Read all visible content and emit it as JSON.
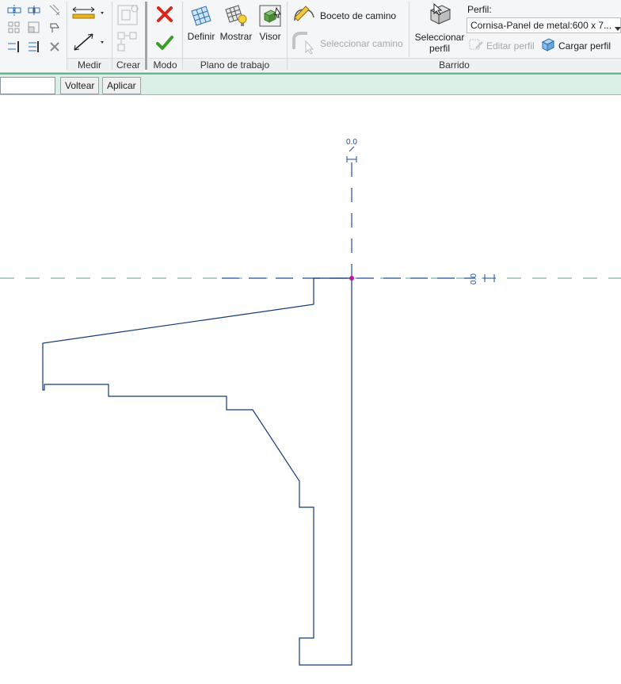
{
  "ribbon": {
    "panels": {
      "medir": "Medir",
      "crear": "Crear",
      "modo": "Modo",
      "plano": "Plano de trabajo",
      "barrido": "Barrido"
    },
    "buttons": {
      "definir": "Definir",
      "mostrar": "Mostrar",
      "visor": "Visor",
      "boceto_camino": "Boceto de camino",
      "seleccionar_camino": "Seleccionar camino",
      "seleccionar_perfil_1": "Seleccionar",
      "seleccionar_perfil_2": "perfil",
      "editar_perfil": "Editar perfil",
      "cargar_perfil": "Cargar perfil"
    },
    "profile": {
      "label": "Perfil:",
      "value": "Cornisa-Panel de metal:600 x 7..."
    }
  },
  "options_bar": {
    "input_value": "",
    "voltear": "Voltear",
    "aplicar": "Aplicar"
  },
  "canvas": {
    "ref_label_top": "0.0",
    "ref_label_right": "0.0"
  },
  "colors": {
    "accent_green": "#5fb88f",
    "sketch_blue": "#123a78",
    "origin_magenta": "#c0188c",
    "cancel_red": "#d9261c",
    "finish_green": "#3a9a2c"
  }
}
